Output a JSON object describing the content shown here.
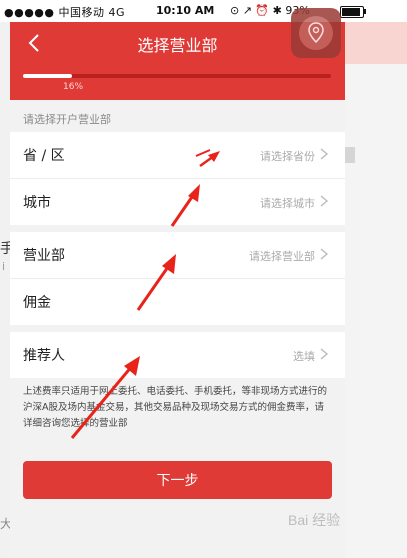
{
  "status_bar": {
    "carrier": "●●●●● 中国移动  4G",
    "time": "10:10 AM",
    "indicators": "⊙ ↗ ⏰ ✱ 93%"
  },
  "background": {
    "left_text": "手",
    "left_text2": "i",
    "left_text3": "大"
  },
  "header": {
    "title": "选择营业部",
    "back_icon": "chevron-left-icon",
    "progress_percent": 16,
    "progress_label": "16%",
    "location_icon": "location-pin-icon"
  },
  "section": {
    "label": "请选择开户营业部"
  },
  "form": {
    "group1": [
      {
        "label": "省 / 区",
        "placeholder": "请选择省份"
      },
      {
        "label": "城市",
        "placeholder": "请选择城市"
      }
    ],
    "group2": [
      {
        "label": "营业部",
        "placeholder": "请选择营业部"
      },
      {
        "label": "佣金",
        "placeholder": ""
      }
    ],
    "group3": [
      {
        "label": "推荐人",
        "placeholder": "选填"
      }
    ]
  },
  "disclaimer": "上述费率只适用于网上委托、电话委托、手机委托，等非现场方式进行的沪深A股及场内基金交易，其他交易品种及现场交易方式的佣金费率，请详细咨询您选择的营业部",
  "next_button": "下一步",
  "watermark": "Bai 经验",
  "colors": {
    "brand_red": "#e03a36",
    "annotation_red": "#e8231a"
  }
}
